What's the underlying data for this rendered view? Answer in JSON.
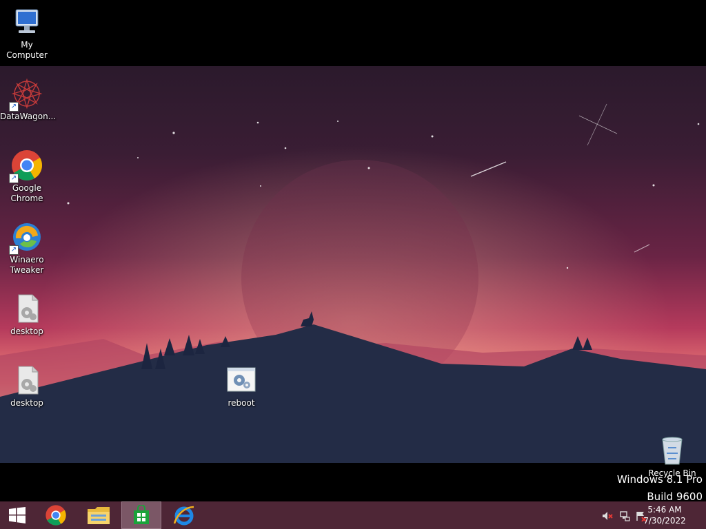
{
  "desktop": {
    "icons": [
      {
        "label": "My Computer",
        "icon": "computer-icon"
      },
      {
        "label": "DataWagon...",
        "icon": "datawagon-icon"
      },
      {
        "label": "Google\nChrome",
        "icon": "chrome-icon"
      },
      {
        "label": "Winaero\nTweaker",
        "icon": "winaero-icon"
      },
      {
        "label": "desktop",
        "icon": "script-file-icon"
      },
      {
        "label": "desktop",
        "icon": "script-file-icon"
      },
      {
        "label": "reboot",
        "icon": "settings-file-icon"
      },
      {
        "label": "Recycle Bin",
        "icon": "recycle-bin-icon"
      }
    ]
  },
  "watermark": {
    "line1": "Windows 8.1 Pro",
    "line2": "Build 9600"
  },
  "taskbar": {
    "start": "start-icon",
    "pinned": [
      "chrome-icon",
      "file-explorer-icon",
      "store-icon",
      "internet-explorer-icon"
    ],
    "active_index": 2,
    "tray_icons": [
      "volume-muted-icon",
      "network-icon",
      "action-center-icon"
    ],
    "time": "5:46 AM",
    "date": "7/30/2022"
  },
  "colors": {
    "taskbar": "#4e2636",
    "accent": "#7b5766"
  }
}
